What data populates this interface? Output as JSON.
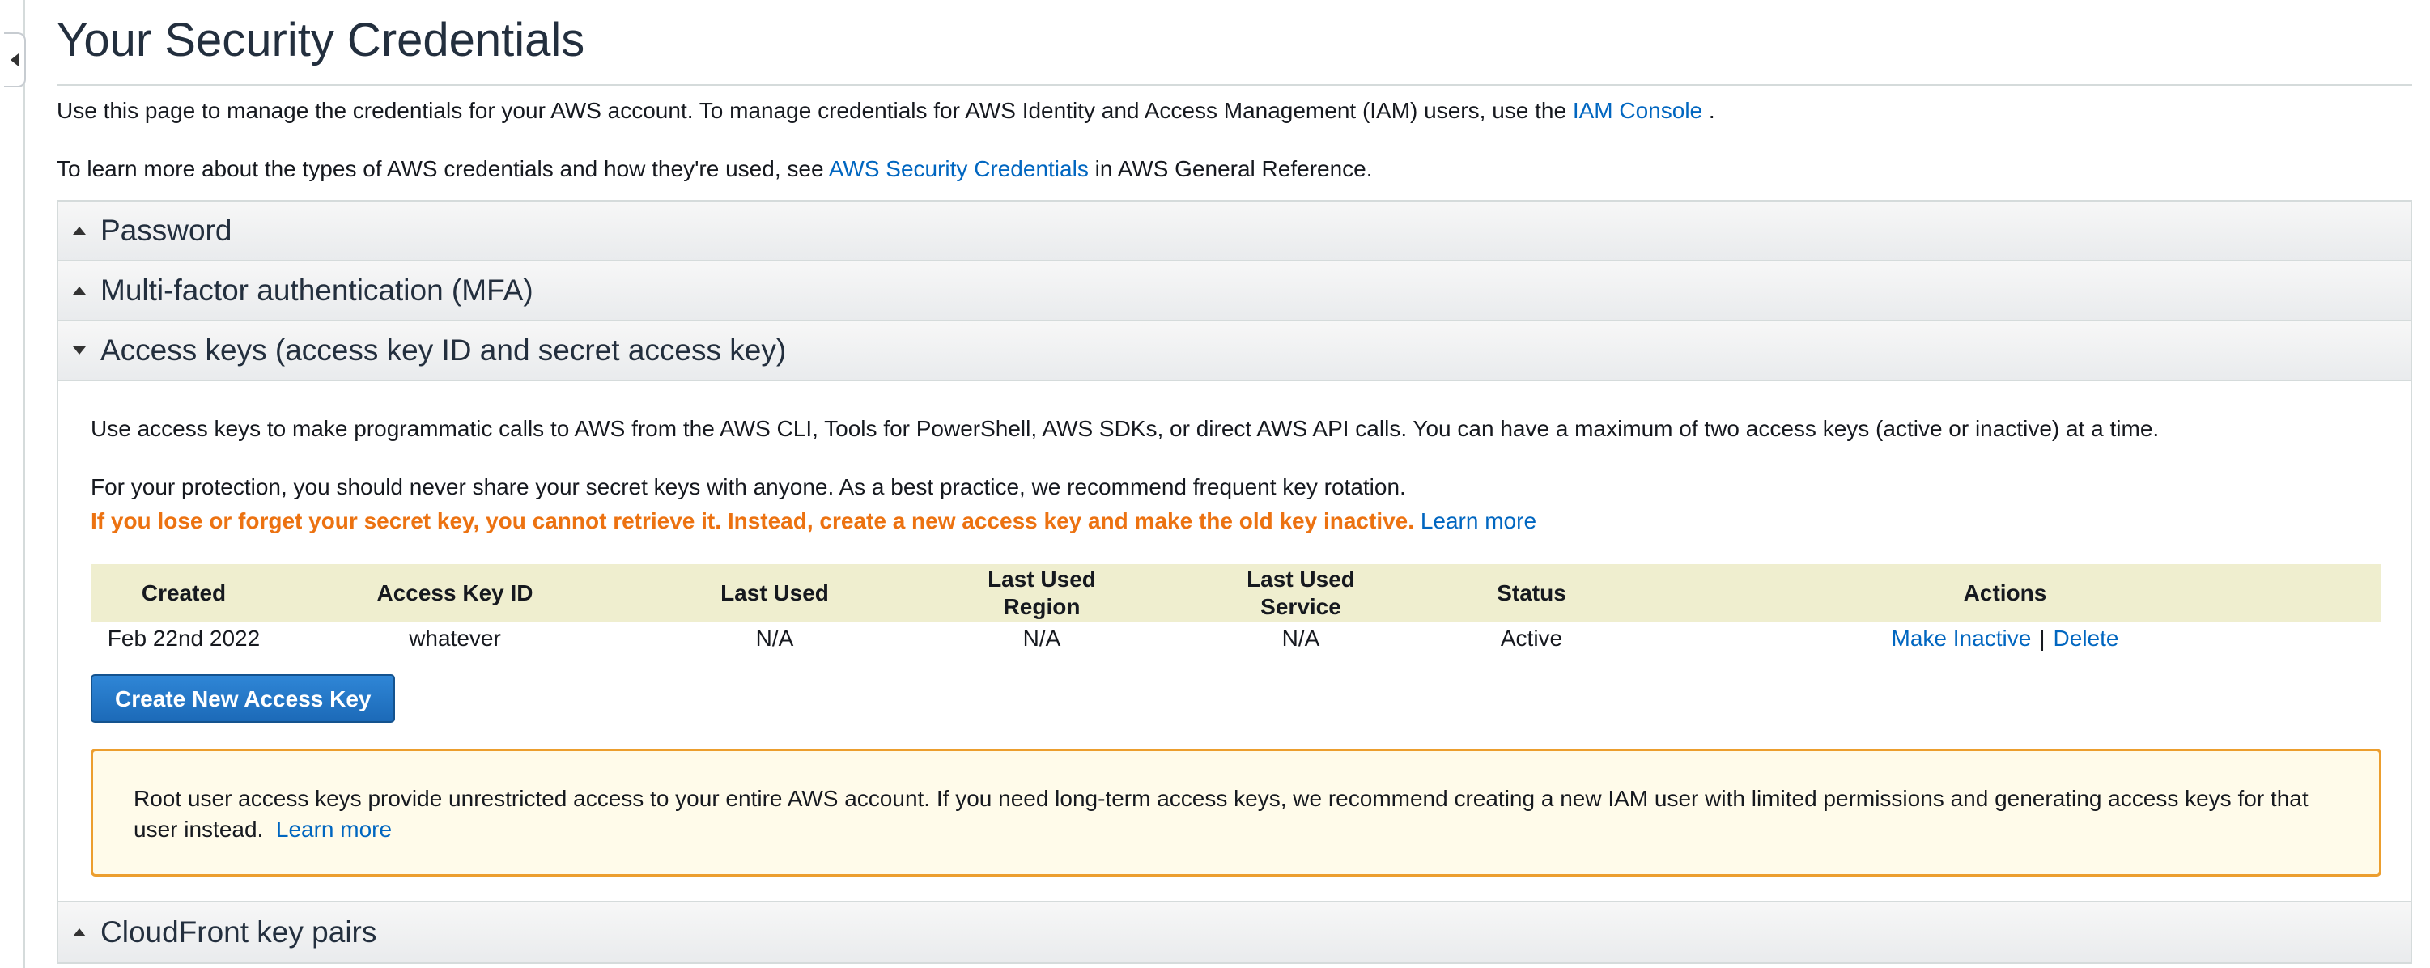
{
  "page": {
    "title": "Your Security Credentials",
    "intro1_text": "Use this page to manage the credentials for your AWS account. To manage credentials for AWS Identity and Access Management (IAM) users, use the",
    "intro1_link": "IAM Console",
    "intro1_end": ".",
    "intro2_text": "To learn more about the types of AWS credentials and how they're used, see",
    "intro2_link": "AWS Security Credentials",
    "intro2_end": "in AWS General Reference."
  },
  "sections": {
    "password": "Password",
    "mfa": "Multi-factor authentication (MFA)",
    "access_keys": "Access keys (access key ID and secret access key)",
    "cloudfront": "CloudFront key pairs"
  },
  "access_keys": {
    "desc": "Use access keys to make programmatic calls to AWS from the AWS CLI, Tools for PowerShell, AWS SDKs, or direct AWS API calls. You can have a maximum of two access keys (active or inactive) at a time.",
    "protection": "For your protection, you should never share your secret keys with anyone. As a best practice, we recommend frequent key rotation.",
    "warning": "If you lose or forget your secret key, you cannot retrieve it. Instead, create a new access key and make the old key inactive.",
    "learn_more": "Learn more",
    "table": {
      "headers": [
        "Created",
        "Access Key ID",
        "Last Used",
        "Last Used\nRegion",
        "Last Used\nService",
        "Status",
        "Actions"
      ],
      "rows": [
        {
          "created": "Feb 22nd 2022",
          "key_id": "whatever",
          "last_used": "N/A",
          "region": "N/A",
          "service": "N/A",
          "status": "Active",
          "action_inactive": "Make Inactive",
          "action_sep": "|",
          "action_delete": "Delete"
        }
      ]
    },
    "create_button": "Create New Access Key",
    "alert_text": "Root user access keys provide unrestricted access to your entire AWS account. If you need long-term access keys, we recommend creating a new IAM user with limited permissions and generating access keys for that user instead.",
    "alert_link": "Learn more"
  },
  "colors": {
    "link": "#0066c0",
    "warning": "#ec7211",
    "button": "#1c6ab8",
    "table_header": "#efeecf",
    "alert_border": "#ec9e2e",
    "alert_bg": "#fffbea"
  }
}
